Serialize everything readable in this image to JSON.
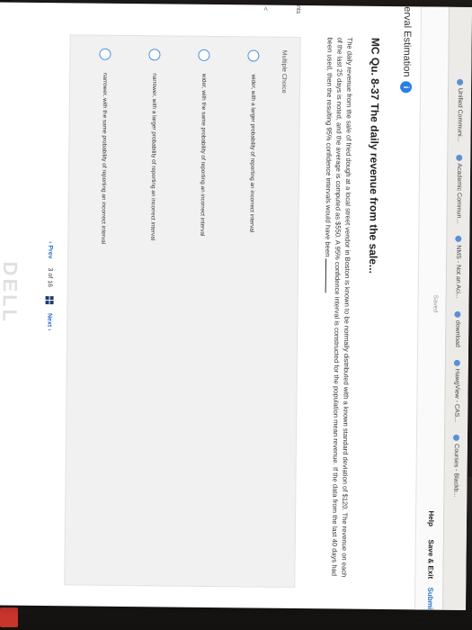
{
  "bookmarks": [
    {
      "label": "Unified Communi..."
    },
    {
      "label": "Academic Commun..."
    },
    {
      "label": "NMS - Not an Aci..."
    },
    {
      "label": "download"
    },
    {
      "label": "HawgView - CAS..."
    },
    {
      "label": "Courses - Blackb..."
    }
  ],
  "topbar": {
    "saved": "Saved",
    "help": "Help",
    "save_exit": "Save & Exit",
    "submit": "Submit"
  },
  "tab_title": "erval Estimation",
  "side": {
    "label": "nts",
    "mark": "<"
  },
  "question": {
    "title": "MC Qu. 8-37 The daily revenue from the sale...",
    "body": "The daily revenue from the sale of fried dough at a local street vendor in Boston is known to be normally distributed with a known standard deviation of $120. The revenue on each of the last 25 days is noted, and the average is computed as $550. A 95% confidence interval is constructed for the population mean revenue. If the data from the last 40 days had been used, then the resulting 95% confidence intervals would have been"
  },
  "multiple_choice": {
    "label": "Multiple Choice",
    "options": [
      "wider, with a larger probability of reporting an incorrect interval",
      "wider, with the same probability of reporting an incorrect interval",
      "narrower, with a larger probability of reporting an incorrect interval",
      "narrower, with the same probability of reporting an incorrect interval"
    ]
  },
  "pager": {
    "prev": "Prev",
    "current": "3",
    "of": "of",
    "total": "16",
    "next": "Next"
  },
  "device_brand": "DELL",
  "colors": {
    "accent": "#2a6fc9",
    "radio": "#4a90e2",
    "panel": "#f1f1f1"
  }
}
